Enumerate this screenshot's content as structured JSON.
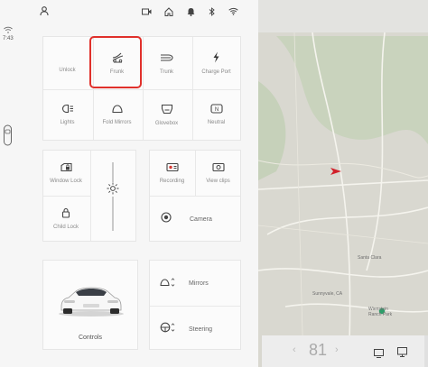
{
  "status": {
    "time": "7:43"
  },
  "quick_controls": {
    "tiles": [
      {
        "label": "Unlock",
        "icon": "unlock-icon"
      },
      {
        "label": "Frunk",
        "icon": "frunk-icon"
      },
      {
        "label": "Trunk",
        "icon": "trunk-icon"
      },
      {
        "label": "Charge Port",
        "icon": "charge-port-icon"
      },
      {
        "label": "Lights",
        "icon": "lights-icon"
      },
      {
        "label": "Fold Mirrors",
        "icon": "fold-mirrors-icon"
      },
      {
        "label": "Glovebox",
        "icon": "glovebox-icon"
      },
      {
        "label": "Neutral",
        "icon": "neutral-icon"
      }
    ],
    "highlighted": "Frunk"
  },
  "locks": {
    "window_lock": "Window Lock",
    "child_lock": "Child Lock"
  },
  "media": {
    "recording": "Recording",
    "view_clips": "View clips",
    "camera": "Camera"
  },
  "adjust": {
    "mirrors": "Mirrors",
    "steering": "Steering"
  },
  "controls": {
    "label": "Controls"
  },
  "map": {
    "labels": [
      "Santa Clara",
      "Sunnyvale, CA",
      "Wienstein Ranch Park"
    ]
  },
  "bottom_bar": {
    "temperature": "81"
  },
  "colors": {
    "highlight": "#e0302b",
    "nav_arrow": "#d1202a",
    "map_pin": "#2e9e6a"
  }
}
